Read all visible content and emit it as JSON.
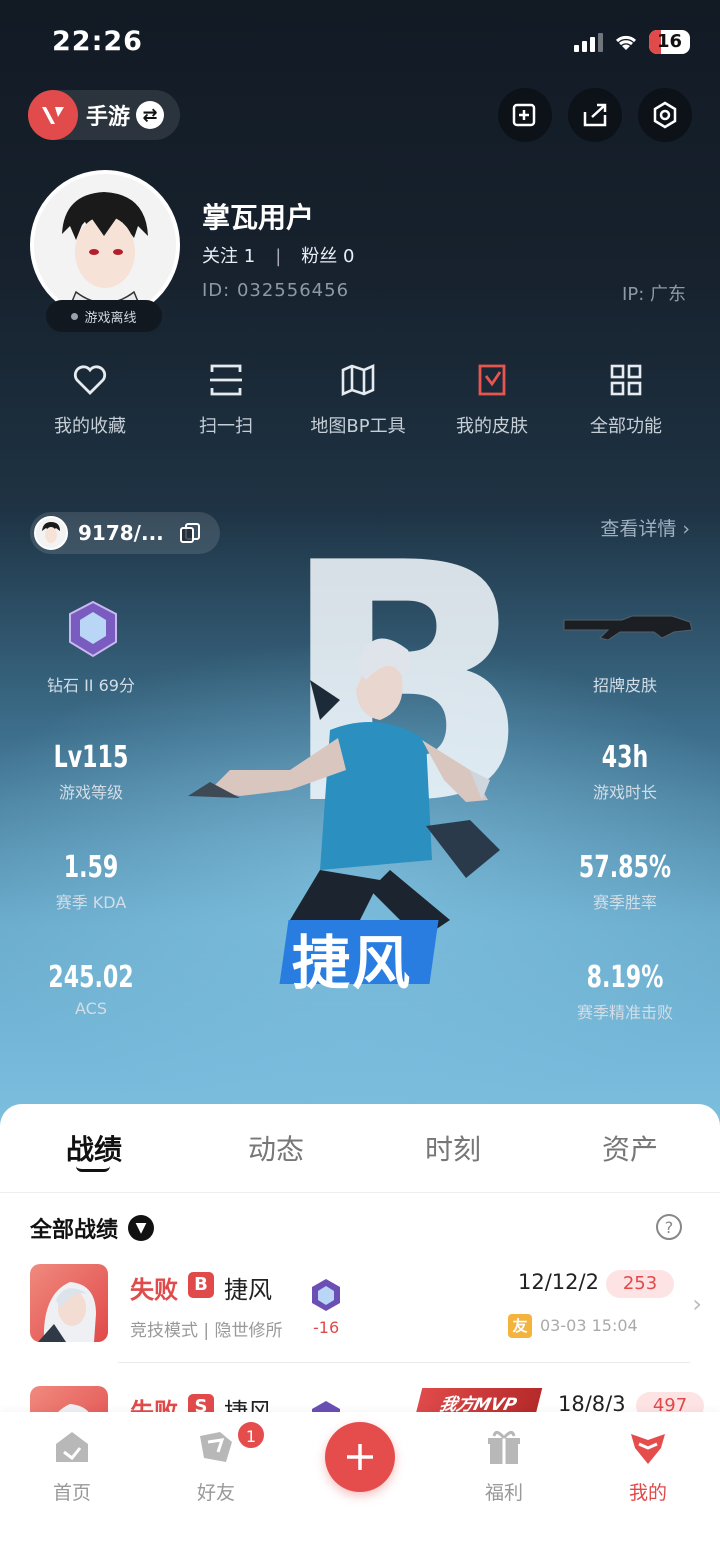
{
  "status_bar": {
    "time": "22:26",
    "battery": "16"
  },
  "header": {
    "game_label": "手游"
  },
  "profile": {
    "username": "掌瓦用户",
    "follow_label": "关注 1",
    "fans_label": "粉丝 0",
    "follow_sep": "|",
    "uid": "ID: 032556456",
    "ip": "IP: 广东",
    "status": "游戏离线"
  },
  "quick_functions": [
    {
      "label": "我的收藏",
      "icon": "heart-icon"
    },
    {
      "label": "扫一扫",
      "icon": "scan-icon"
    },
    {
      "label": "地图BP工具",
      "icon": "map-icon"
    },
    {
      "label": "我的皮肤",
      "icon": "skin-icon"
    },
    {
      "label": "全部功能",
      "icon": "grid-icon"
    }
  ],
  "gamer": {
    "id": "9178/...",
    "detail_link": "查看详情"
  },
  "showcase": {
    "grade_letter": "B",
    "agent": "捷风",
    "rank_label": "钻石 II 69分",
    "skin_label": "招牌皮肤",
    "stats": [
      {
        "value": "Lv115",
        "label": "游戏等级"
      },
      {
        "value": "43h",
        "label": "游戏时长"
      },
      {
        "value": "1.59",
        "label": "赛季 KDA"
      },
      {
        "value": "57.85%",
        "label": "赛季胜率"
      },
      {
        "value": "245.02",
        "label": "ACS"
      },
      {
        "value": "8.19%",
        "label": "赛季精准击败"
      }
    ]
  },
  "tabs": [
    "战绩",
    "动态",
    "时刻",
    "资产"
  ],
  "filter": {
    "label": "全部战绩",
    "help": "?"
  },
  "matches": [
    {
      "result": "失败",
      "grade": "B",
      "agent": "捷风",
      "mode": "竞技模式 | 隐世修所",
      "rank_delta": "-16",
      "kda": "12/12/2",
      "score": "253",
      "friend_tag": "友",
      "time": "03-03 15:04"
    },
    {
      "result": "失败",
      "grade": "S",
      "agent": "捷风",
      "mvp": "我方MVP",
      "kda": "18/8/3",
      "score": "497"
    }
  ],
  "bottom_nav": [
    {
      "label": "首页",
      "icon": "home-icon"
    },
    {
      "label": "好友",
      "icon": "friends-icon",
      "badge": "1"
    },
    {
      "label": "福利",
      "icon": "gift-icon"
    },
    {
      "label": "我的",
      "icon": "profile-icon"
    }
  ],
  "colors": {
    "accent": "#e54d4d",
    "hero_top": "#121a24",
    "hero_bottom": "#7cbfdf"
  }
}
